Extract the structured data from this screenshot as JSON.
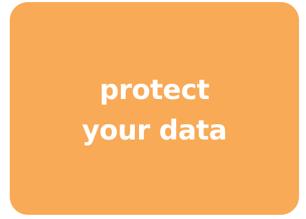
{
  "card": {
    "background_color": "#F8AA57",
    "text_color": "#FFFFFF",
    "lines": [
      "protect",
      "your data"
    ]
  }
}
